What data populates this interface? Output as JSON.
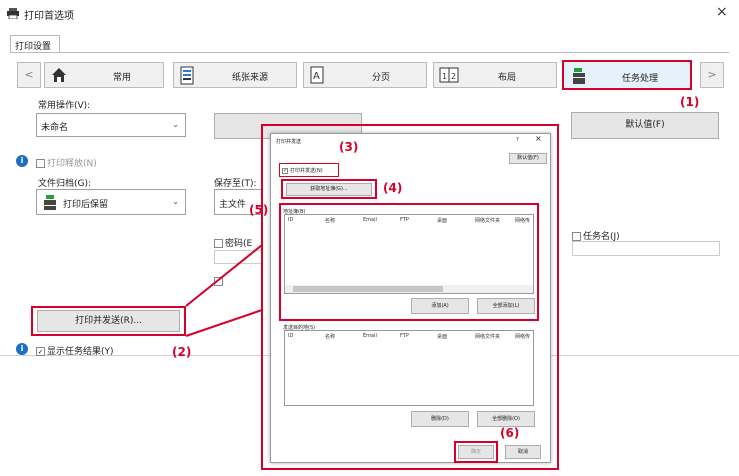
{
  "window": {
    "title": "打印首选项",
    "close": "×"
  },
  "tab": {
    "label": "打印设置"
  },
  "nav": {
    "prev": "<",
    "next": ">",
    "buttons": [
      {
        "label": "常用",
        "icon": "home-icon"
      },
      {
        "label": "纸张来源",
        "icon": "paper-tray-icon"
      },
      {
        "label": "分页",
        "icon": "page-icon"
      },
      {
        "label": "布局",
        "icon": "layout-icon"
      },
      {
        "label": "任务处理",
        "icon": "job-handling-icon"
      }
    ]
  },
  "common_ops": {
    "label": "常用操作(V):",
    "value": "未命名",
    "default_button": "默认值(F)"
  },
  "print_release": {
    "label": "打印释放(N)"
  },
  "doc_filing": {
    "label": "文件归档(G):",
    "value": "打印后保留",
    "save_to_label": "保存至(T):",
    "save_to_value": "主文件"
  },
  "password": {
    "label": "密码(E"
  },
  "task_name": {
    "label": "任务名(J)"
  },
  "print_and_send_button": "打印并发送(R)...",
  "show_result": {
    "label": "显示任务结果(Y)"
  },
  "callouts": [
    "(1)",
    "(2)",
    "(3)",
    "(4)",
    "(5)",
    "(6)"
  ],
  "dialog": {
    "title": "打印并发送",
    "help": "?",
    "close": "×",
    "default_button": "默认值(F)",
    "checkbox": "打印并发送(N)",
    "get_address_button": "获取地址簿(G)...",
    "address_book_label": "地址簿(B)",
    "columns": [
      "ID",
      "名称",
      "Email",
      "FTP",
      "桌面",
      "网络文件夹",
      "网络传"
    ],
    "add_button": "添加(A)",
    "add_all_button": "全部添加(L)",
    "send_to_label": "发送目的地(S)",
    "delete_button": "删除(D)",
    "delete_all_button": "全部删除(O)",
    "ok_button": "确定",
    "cancel_button": "取消"
  }
}
